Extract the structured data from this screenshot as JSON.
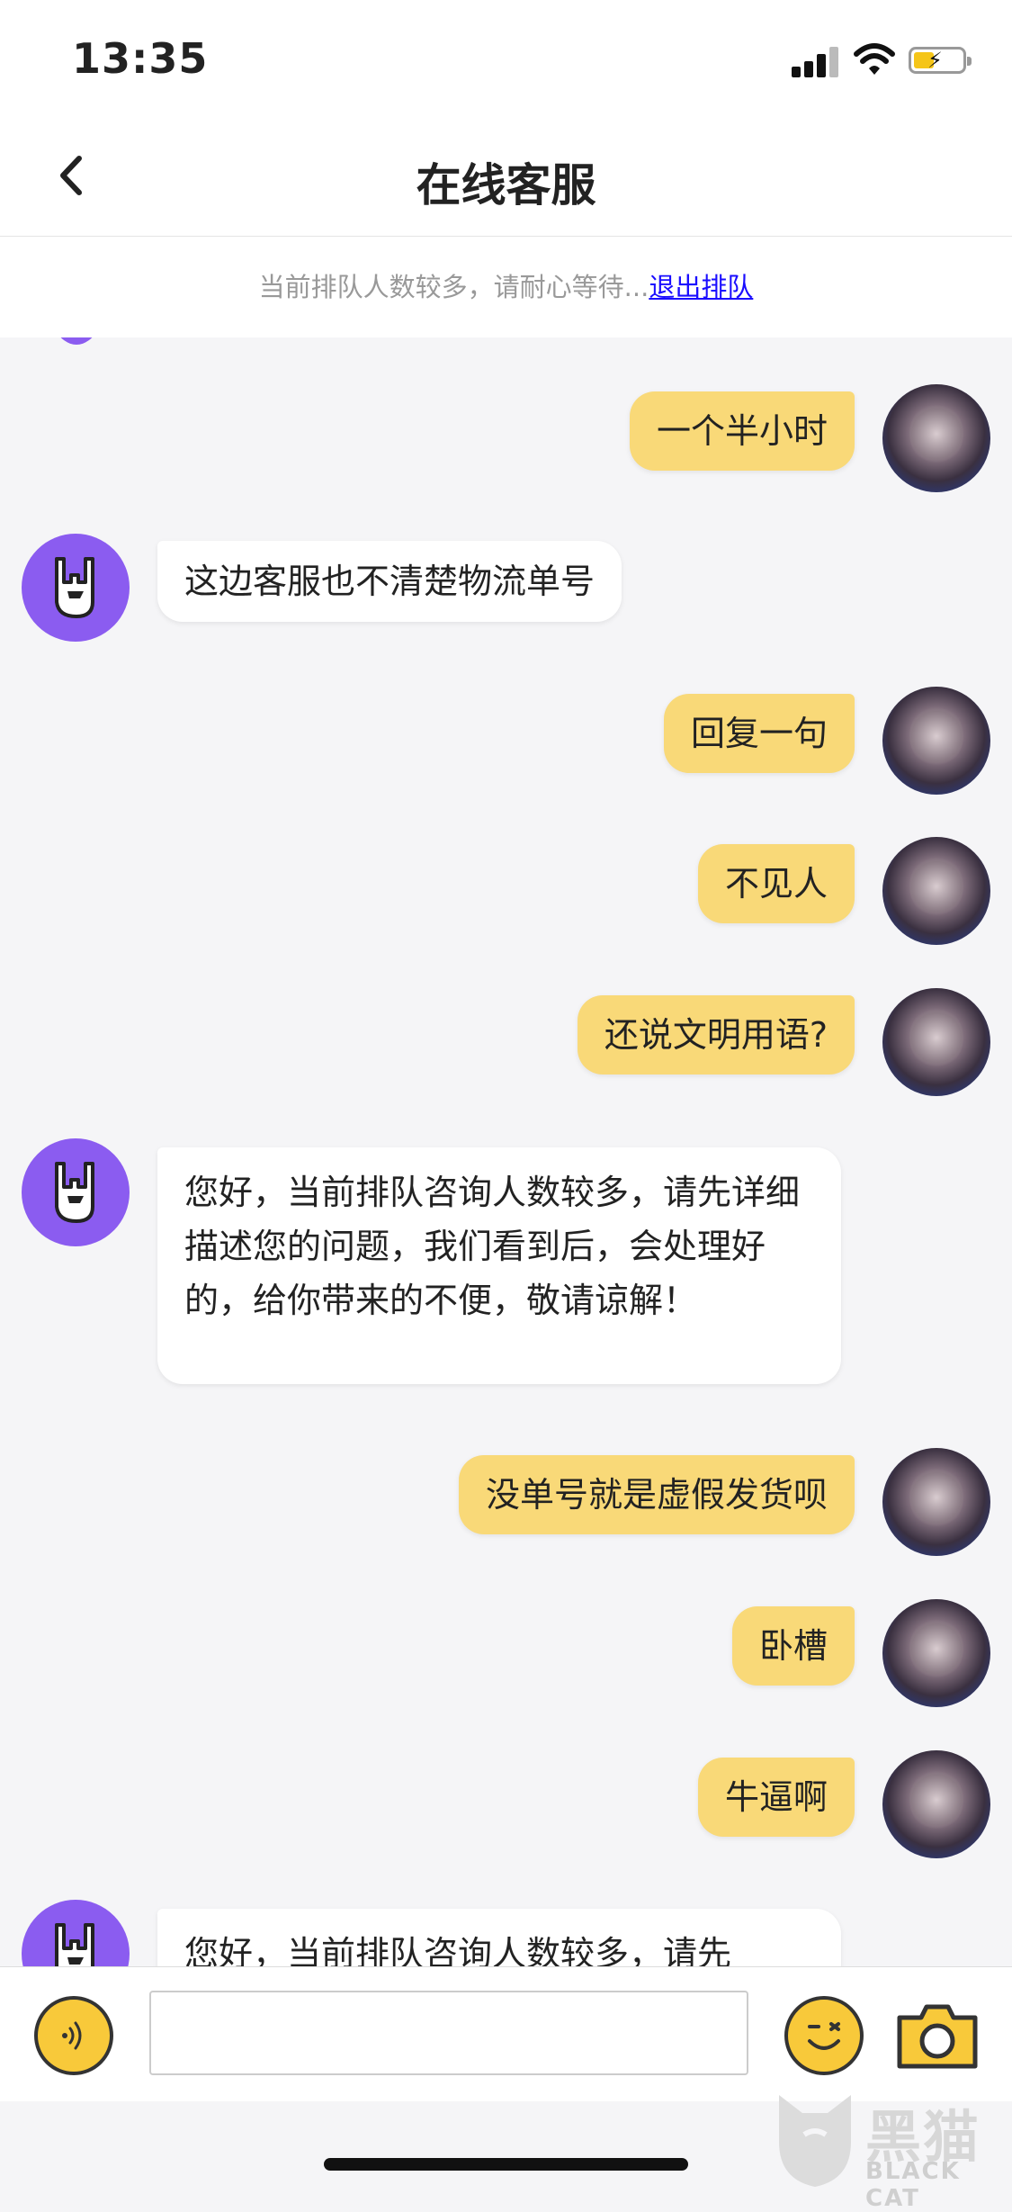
{
  "status_bar": {
    "time": "13:35"
  },
  "header": {
    "title": "在线客服"
  },
  "queue": {
    "text": "当前排队人数较多，请耐心等待...",
    "link_label": "退出排队"
  },
  "messages": [
    {
      "sender": "user",
      "text": "一个半小时"
    },
    {
      "sender": "agent",
      "text": "这边客服也不清楚物流单号"
    },
    {
      "sender": "user",
      "text": "回复一句"
    },
    {
      "sender": "user",
      "text": "不见人"
    },
    {
      "sender": "user",
      "text": "还说文明用语?"
    },
    {
      "sender": "agent",
      "text": "您好，当前排队咨询人数较多，请先详细描述您的问题，我们看到后，会处理好的，给你带来的不便，敬请谅解！"
    },
    {
      "sender": "user",
      "text": "没单号就是虚假发货呗"
    },
    {
      "sender": "user",
      "text": "卧槽"
    },
    {
      "sender": "user",
      "text": "牛逼啊"
    },
    {
      "sender": "agent",
      "text": "您好，当前排队咨询人数较多，请先"
    }
  ],
  "input_bar": {
    "message_value": ""
  },
  "watermark": {
    "cn": "黑猫",
    "en": "BLACK CAT"
  },
  "colors": {
    "user_bubble": "#f9d978",
    "agent_bubble": "#ffffff",
    "agent_avatar": "#8b5cf0",
    "accent": "#f8c93a",
    "link": "#1a0dff"
  },
  "icons": [
    "back-arrow-icon",
    "signal-icon",
    "wifi-icon",
    "battery-icon",
    "voice-icon",
    "emoji-icon",
    "camera-icon",
    "rock-hand-icon"
  ]
}
